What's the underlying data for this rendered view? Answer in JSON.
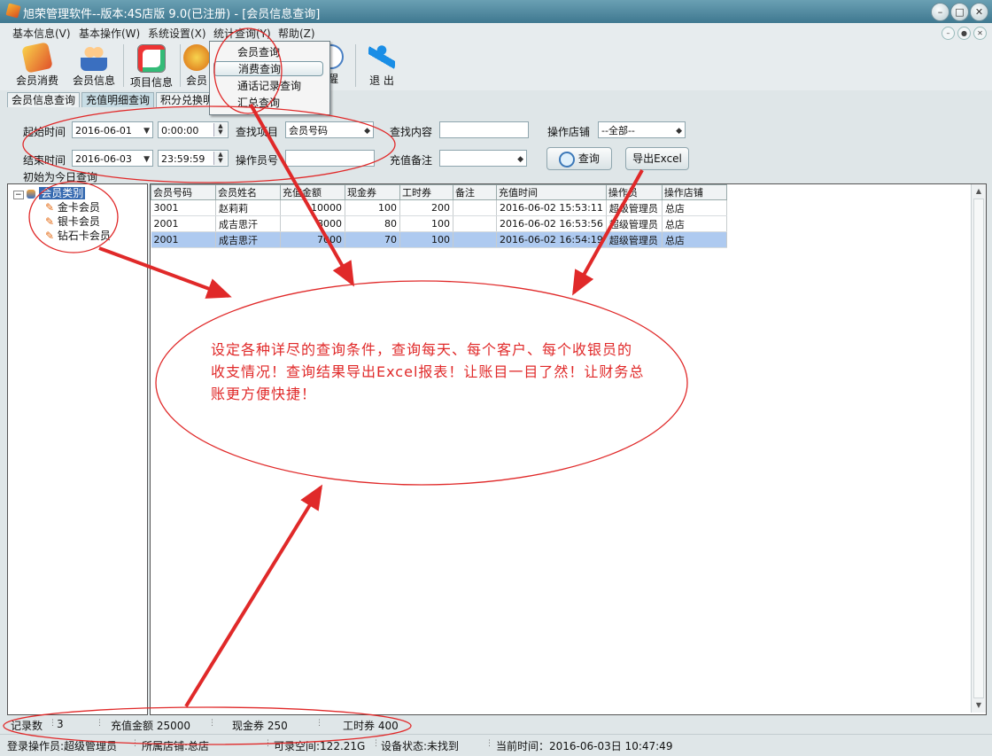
{
  "window": {
    "title": "旭荣管理软件--版本:4S店版 9.0(已注册) - [会员信息查询]"
  },
  "menu": [
    "基本信息(V)",
    "基本操作(W)",
    "系统设置(X)",
    "统计查询(Y)",
    "帮助(Z)"
  ],
  "toolbar": {
    "items": [
      "会员消费",
      "会员信息",
      "项目信息",
      "会员",
      "醒",
      "退 出"
    ]
  },
  "dropdown": {
    "items": [
      "会员查询",
      "消费查询",
      "通话记录查询",
      "汇总查询"
    ],
    "highlighted_index": 1
  },
  "tabs": [
    "会员信息查询",
    "充值明细查询",
    "积分兑换明"
  ],
  "form": {
    "start_label": "起始时间",
    "start_date": "2016-06-01",
    "start_time": "0:00:00",
    "end_label": "结束时间",
    "end_date": "2016-06-03",
    "end_time": "23:59:59",
    "find_item_label": "查找项目",
    "find_item_value": "会员号码",
    "find_content_label": "查找内容",
    "find_content_value": "",
    "operator_label": "操作员号",
    "operator_value": "",
    "remark_label": "充值备注",
    "remark_value": "",
    "store_label": "操作店铺",
    "store_value": "--全部--",
    "query_button": "查询",
    "export_button": "导出Excel",
    "hint": "初始为今日查询"
  },
  "tree": {
    "root": "会员类别",
    "children": [
      "金卡会员",
      "银卡会员",
      "钻石卡会员"
    ]
  },
  "table": {
    "columns": [
      "会员号码",
      "会员姓名",
      "充值金额",
      "现金券",
      "工时券",
      "备注",
      "充值时间",
      "操作员",
      "操作店铺"
    ],
    "rows": [
      [
        "3001",
        "赵莉莉",
        "10000",
        "100",
        "200",
        "",
        "2016-06-02 15:53:11",
        "超级管理员",
        "总店"
      ],
      [
        "2001",
        "成吉思汗",
        "8000",
        "80",
        "100",
        "",
        "2016-06-02 16:53:56",
        "超级管理员",
        "总店"
      ],
      [
        "2001",
        "成吉思汗",
        "7000",
        "70",
        "100",
        "",
        "2016-06-02 16:54:19",
        "超级管理员",
        "总店"
      ]
    ],
    "selected_row": 2
  },
  "summary": {
    "count_label": "记录数",
    "count_value": "3",
    "recharge": "充值金额 25000",
    "cash": "现金券 250",
    "hours": "工时券 400"
  },
  "status": {
    "operator": "登录操作员:超级管理员",
    "store": "所属店铺:总店",
    "space": "可录空间:122.21G",
    "device": "设备状态:未找到",
    "time": "当前时间：2016-06-03日 10:47:49"
  },
  "annotation": {
    "text": "设定各种详尽的查询条件，查询每天、每个客户、每个收银员的收支情况！查询结果导出Excel报表！让账目一目了然！让财务总账更方便快捷！",
    "color": "#e02929"
  }
}
